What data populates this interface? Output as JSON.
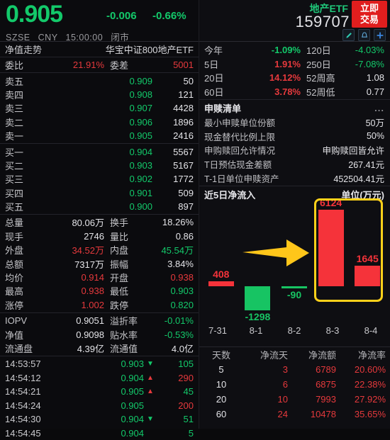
{
  "header": {
    "price": "0.905",
    "change": "-0.006",
    "change_pct": "-0.66%",
    "exchange": "SZSE",
    "currency": "CNY",
    "time": "15:00:00",
    "market_status": "闭市",
    "etf_name": "地产ETF",
    "etf_code": "159707",
    "trade_button_line1": "立即",
    "trade_button_line2": "交易",
    "icons": [
      "edit-icon",
      "alert-bell-icon",
      "add-icon"
    ]
  },
  "fund_title": {
    "left_label": "净值走势",
    "name": "华宝中证800地产ETF"
  },
  "order_ratio": {
    "label": "委比",
    "value": "21.91%",
    "diff_label": "委差",
    "diff_value": "5001"
  },
  "asks": [
    {
      "name": "卖五",
      "price": "0.909",
      "qty": "50"
    },
    {
      "name": "卖四",
      "price": "0.908",
      "qty": "121"
    },
    {
      "name": "卖三",
      "price": "0.907",
      "qty": "4428"
    },
    {
      "name": "卖二",
      "price": "0.906",
      "qty": "1896"
    },
    {
      "name": "卖一",
      "price": "0.905",
      "qty": "2416"
    }
  ],
  "bids": [
    {
      "name": "买一",
      "price": "0.904",
      "qty": "5567"
    },
    {
      "name": "买二",
      "price": "0.903",
      "qty": "5167"
    },
    {
      "name": "买三",
      "price": "0.902",
      "qty": "1772"
    },
    {
      "name": "买四",
      "price": "0.901",
      "qty": "509"
    },
    {
      "name": "买五",
      "price": "0.900",
      "qty": "897"
    }
  ],
  "stats": [
    {
      "k1": "总量",
      "v1": "80.06万",
      "v1c": "w",
      "k2": "换手",
      "v2": "18.26%",
      "v2c": "w"
    },
    {
      "k1": "现手",
      "v1": "2746",
      "v1c": "w",
      "k2": "量比",
      "v2": "0.86",
      "v2c": "w"
    },
    {
      "k1": "外盘",
      "v1": "34.52万",
      "v1c": "r",
      "k2": "内盘",
      "v2": "45.54万",
      "v2c": "g"
    },
    {
      "k1": "总额",
      "v1": "7317万",
      "v1c": "w",
      "k2": "振幅",
      "v2": "3.84%",
      "v2c": "w"
    },
    {
      "k1": "均价",
      "v1": "0.914",
      "v1c": "r",
      "k2": "开盘",
      "v2": "0.938",
      "v2c": "r"
    },
    {
      "k1": "最高",
      "v1": "0.938",
      "v1c": "r",
      "k2": "最低",
      "v2": "0.903",
      "v2c": "g"
    },
    {
      "k1": "涨停",
      "v1": "1.002",
      "v1c": "r",
      "k2": "跌停",
      "v2": "0.820",
      "v2c": "g"
    }
  ],
  "stats2": [
    {
      "k1": "IOPV",
      "v1": "0.9051",
      "v1c": "w",
      "k2": "溢折率",
      "v2": "-0.01%",
      "v2c": "g"
    },
    {
      "k1": "净值",
      "v1": "0.9098",
      "v1c": "w",
      "k2": "贴水率",
      "v2": "-0.53%",
      "v2c": "g"
    },
    {
      "k1": "流通盘",
      "v1": "4.39亿",
      "v1c": "w",
      "k2": "流通值",
      "v2": "4.0亿",
      "v2c": "w"
    }
  ],
  "ticks": [
    {
      "time": "14:53:57",
      "price": "0.903",
      "dir": "down",
      "vol": "105",
      "volc": "g"
    },
    {
      "time": "14:54:12",
      "price": "0.904",
      "dir": "up",
      "vol": "290",
      "volc": "r"
    },
    {
      "time": "14:54:21",
      "price": "0.905",
      "dir": "up",
      "vol": "45",
      "volc": "g"
    },
    {
      "time": "14:54:24",
      "price": "0.905",
      "dir": "none",
      "vol": "200",
      "volc": "r"
    },
    {
      "time": "14:54:30",
      "price": "0.904",
      "dir": "down",
      "vol": "51",
      "volc": "g"
    },
    {
      "time": "14:54:45",
      "price": "0.904",
      "dir": "none",
      "vol": "5",
      "volc": "g"
    }
  ],
  "performance": [
    {
      "k1": "今年",
      "v1": "-1.09%",
      "v1c": "g",
      "k2": "120日",
      "v2": "-4.03%",
      "v2c": "g"
    },
    {
      "k1": "5日",
      "v1": "1.91%",
      "v1c": "r",
      "k2": "250日",
      "v2": "-7.08%",
      "v2c": "g"
    },
    {
      "k1": "20日",
      "v1": "14.12%",
      "v1c": "r",
      "k2": "52周高",
      "v2": "1.08",
      "v2c": "w"
    },
    {
      "k1": "60日",
      "v1": "3.78%",
      "v1c": "r",
      "k2": "52周低",
      "v2": "0.77",
      "v2c": "w"
    }
  ],
  "creation_list": {
    "title": "申赎清单",
    "more": "...",
    "rows": [
      {
        "k": "最小申赎单位份额",
        "v": "50万"
      },
      {
        "k": "现金替代比例上限",
        "v": "50%"
      },
      {
        "k": "申购赎回允许情况",
        "v": "申购赎回皆允许"
      },
      {
        "k": "T日预估现金差额",
        "v": "267.41元"
      },
      {
        "k": "T-1日单位申赎资产",
        "v": "452504.41元"
      }
    ]
  },
  "chart_data": {
    "type": "bar",
    "title": "近5日净流入",
    "unit_label": "单位(万元)",
    "xlabel": "",
    "ylabel": "净流入 (万元)",
    "categories": [
      "7-31",
      "8-1",
      "8-2",
      "8-3",
      "8-4"
    ],
    "values": [
      408,
      -1298,
      -90,
      6124,
      1645
    ],
    "labels": [
      "408",
      "-1298",
      "-90",
      "6124",
      "1645"
    ],
    "colors": [
      "#f5333a",
      "#17c463",
      "#17c463",
      "#f5333a",
      "#f5333a"
    ],
    "ylim": [
      -1298,
      6124
    ],
    "grid": false,
    "legend": "none",
    "annotations": [
      {
        "type": "highlight-box",
        "covers": [
          "8-3",
          "8-4"
        ],
        "color": "#ffd11a"
      },
      {
        "type": "arrow",
        "direction": "right",
        "color": "#ffc61a",
        "points_to": "8-3"
      }
    ]
  },
  "flow_table": {
    "headers": [
      "天数",
      "净流天",
      "净流额",
      "净流率"
    ],
    "rows": [
      {
        "days": "5",
        "net_days": "3",
        "net_amt": "6789",
        "net_rate": "20.60%"
      },
      {
        "days": "10",
        "net_days": "6",
        "net_amt": "6875",
        "net_rate": "22.38%"
      },
      {
        "days": "20",
        "net_days": "10",
        "net_amt": "7993",
        "net_rate": "27.92%"
      },
      {
        "days": "60",
        "net_days": "24",
        "net_amt": "10478",
        "net_rate": "35.65%"
      }
    ]
  },
  "colors": {
    "up_red": "#e5393c",
    "down_green": "#13c96a",
    "accent_yellow": "#ffd11a",
    "bg": "#0b0b0e"
  }
}
